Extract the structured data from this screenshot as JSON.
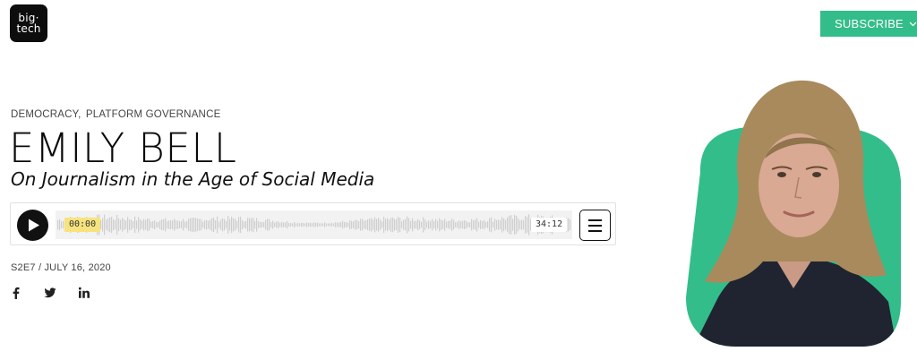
{
  "header": {
    "logo_line1": "big·",
    "logo_line2": "tech",
    "subscribe_label": "SUBSCRIBE"
  },
  "episode": {
    "categories": [
      "DEMOCRACY",
      "PLATFORM GOVERNANCE"
    ],
    "category_separator": ",",
    "title": "EMILY BELL",
    "subtitle": "On Journalism in the Age of Social Media",
    "meta": "S2E7 / JULY 16, 2020"
  },
  "player": {
    "current_time": "00:00",
    "duration": "34:12",
    "progress": 0
  },
  "social": [
    "facebook-icon",
    "twitter-icon",
    "linkedin-icon"
  ],
  "colors": {
    "accent": "#33bd8a",
    "time_highlight": "#f7e37e",
    "dark": "#0d0d0d"
  }
}
